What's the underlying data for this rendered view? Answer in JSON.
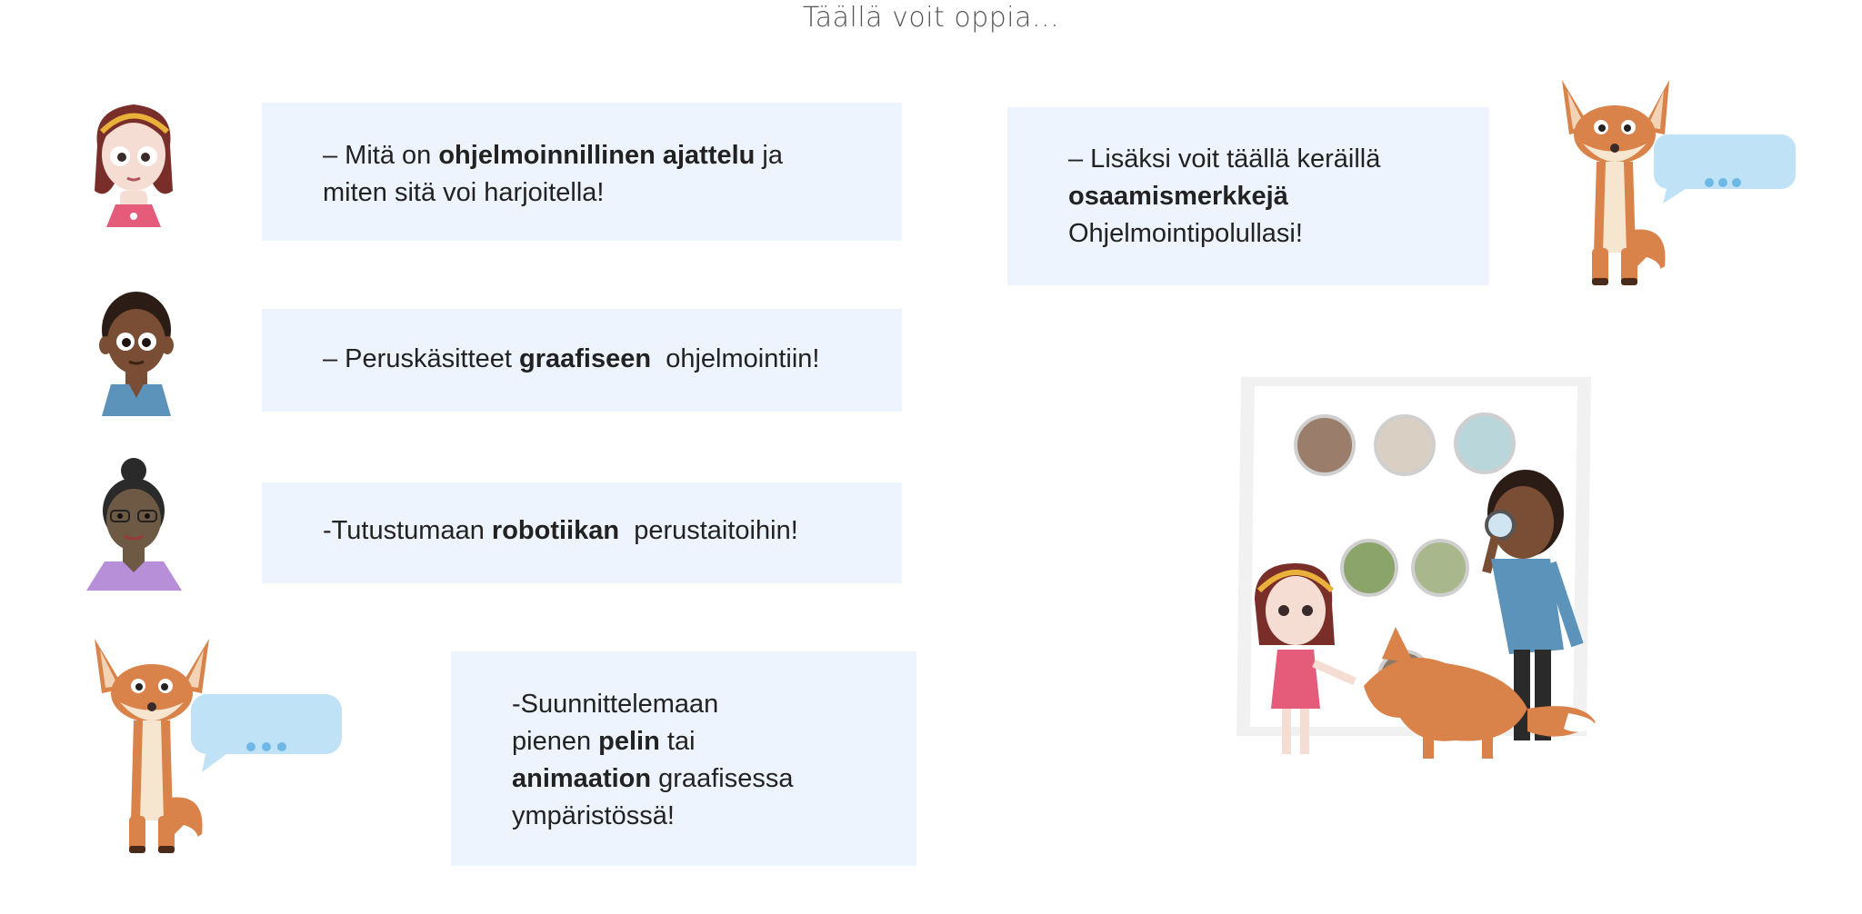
{
  "page": {
    "title": "Täällä voit oppia..."
  },
  "cards": {
    "c1": {
      "p1": "– Mitä on ",
      "b1": "ohjelmoinnillinen ajattelu",
      "p2": " ja",
      "p3": "miten sitä voi harjoitella!"
    },
    "c2": {
      "p1": "– Peruskäsitteet ",
      "b1": "graafiseen",
      "p2": "  ohjelmointiin!"
    },
    "c3": {
      "p1": "-Tutustumaan ",
      "b1": "robotiikan",
      "p2": "  perustaitoihin!"
    },
    "c4": {
      "p1": "-Suunnittelemaan",
      "p2": "pienen ",
      "b1": "pelin",
      "p3": " tai",
      "b2": "animaation",
      "p4": " graafisessa",
      "p5": "ympäristössä!"
    },
    "c5": {
      "p1": "– Lisäksi voit täällä keräillä",
      "b1": "osaamismerkkejä",
      "p2": "Ohjelmointipolullasi!"
    }
  },
  "bubbles": {
    "dots": "•••"
  },
  "colors": {
    "card_bg": "#eef4fd",
    "bubble": "#bfe2f7",
    "bubble_dots": "#6fb8e6",
    "fox": "#d9824a"
  }
}
